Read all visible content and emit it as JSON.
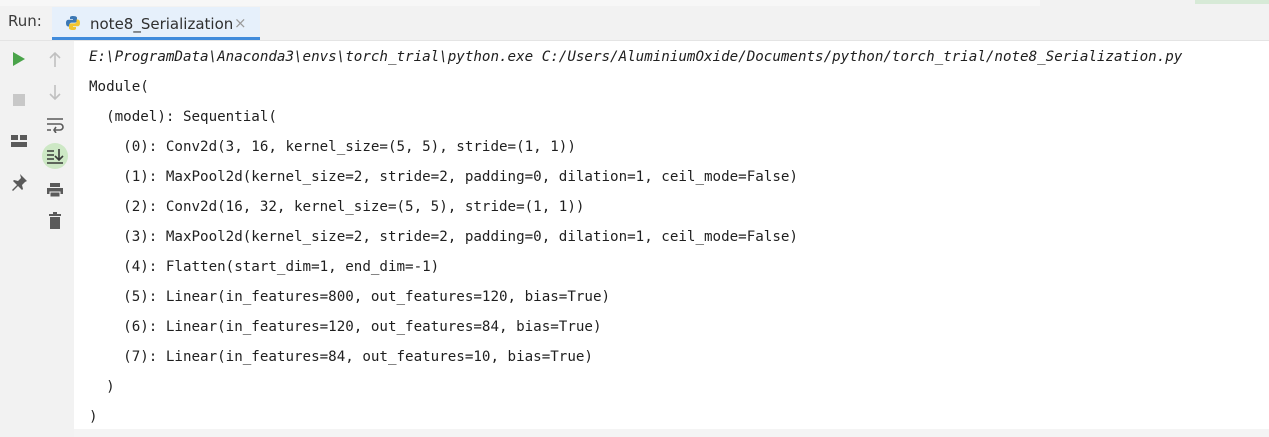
{
  "run_bar": {
    "label": "Run:",
    "tab_title": "note8_Serialization",
    "tab_close": "×"
  },
  "toolbar": {
    "left_column": [
      "run-icon",
      "stop-icon",
      "layout-icon",
      "pin-icon"
    ],
    "right_column": [
      "arrow-up-icon",
      "arrow-down-icon",
      "soft-wrap-icon",
      "scroll-to-end-icon",
      "print-icon",
      "trash-icon"
    ]
  },
  "console": {
    "lines": [
      "E:\\ProgramData\\Anaconda3\\envs\\torch_trial\\python.exe C:/Users/AluminiumOxide/Documents/python/torch_trial/note8_Serialization.py",
      "Module(",
      "  (model): Sequential(",
      "    (0): Conv2d(3, 16, kernel_size=(5, 5), stride=(1, 1))",
      "    (1): MaxPool2d(kernel_size=2, stride=2, padding=0, dilation=1, ceil_mode=False)",
      "    (2): Conv2d(16, 32, kernel_size=(5, 5), stride=(1, 1))",
      "    (3): MaxPool2d(kernel_size=2, stride=2, padding=0, dilation=1, ceil_mode=False)",
      "    (4): Flatten(start_dim=1, end_dim=-1)",
      "    (5): Linear(in_features=800, out_features=120, bias=True)",
      "    (6): Linear(in_features=120, out_features=84, bias=True)",
      "    (7): Linear(in_features=84, out_features=10, bias=True)",
      "  )",
      ")"
    ]
  },
  "colors": {
    "accent_tab_underline": "#3f8bdc",
    "run_green": "#4aa44a",
    "active_toggle": "#cde8c5"
  }
}
